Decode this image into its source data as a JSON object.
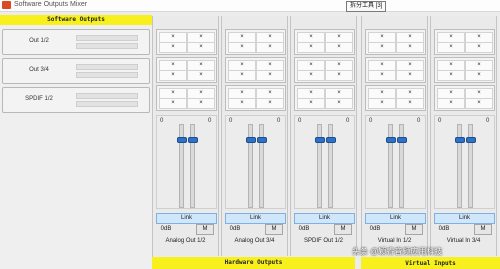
{
  "window": {
    "title": "Software Outputs Mixer",
    "tooltip": "拆分工具 [3]"
  },
  "software_outputs": {
    "header": "Software Outputs",
    "rows": [
      {
        "label": "Out 1/2"
      },
      {
        "label": "Out 3/4"
      },
      {
        "label": "SPDIF 1/2"
      }
    ]
  },
  "columns": [
    {
      "name": "Analog Out 1/2",
      "scale_left": "0",
      "scale_right": "0",
      "link_label": "Link",
      "db_label": "0dB",
      "mute_label": "M"
    },
    {
      "name": "Analog Out 3/4",
      "scale_left": "0",
      "scale_right": "0",
      "link_label": "Link",
      "db_label": "0dB",
      "mute_label": "M"
    },
    {
      "name": "SPDIF Out 1/2",
      "scale_left": "0",
      "scale_right": "0",
      "link_label": "Link",
      "db_label": "0dB",
      "mute_label": "M"
    },
    {
      "name": "Virtual In 1/2",
      "scale_left": "0",
      "scale_right": "0",
      "link_label": "Link",
      "db_label": "0dB",
      "mute_label": "M"
    },
    {
      "name": "Virtual In 3/4",
      "scale_left": "0",
      "scale_right": "0",
      "link_label": "Link",
      "db_label": "0dB",
      "mute_label": "M"
    }
  ],
  "cell_symbol": "×",
  "footer": {
    "hardware_outputs": "Hardware Outputs",
    "virtual_inputs": "Virtual Inputs"
  },
  "watermark": "头条 @颖睿音频应用科技",
  "colors": {
    "header_yellow": "#f7f01d",
    "link_blue": "#cfe6fb",
    "fader_knob": "#2d72c9"
  }
}
